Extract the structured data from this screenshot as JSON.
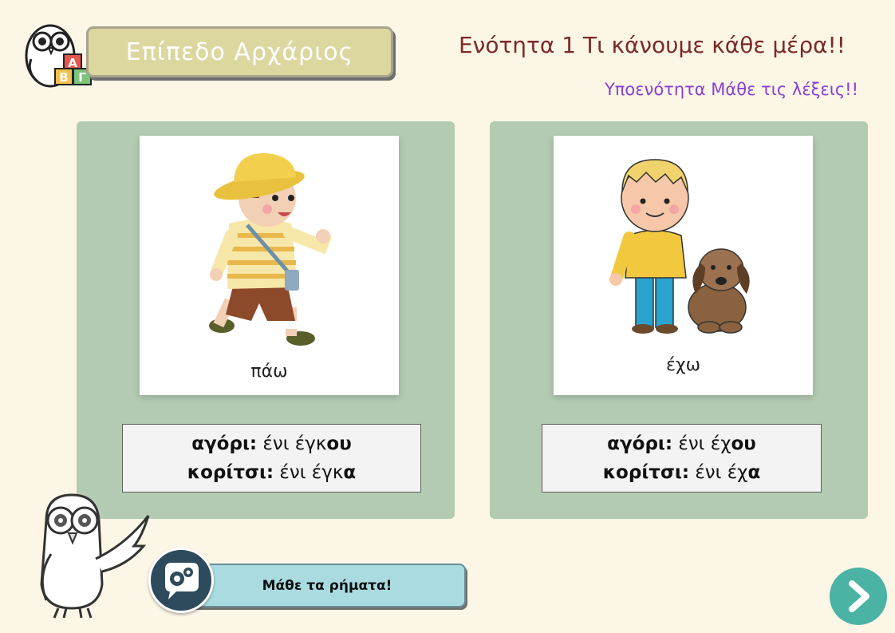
{
  "header": {
    "level_label": "Επίπεδο Αρχάριος",
    "logo_letters": [
      "A",
      "B",
      "Γ"
    ],
    "unit_title": "Ενότητα 1 Τι κάνουμε κάθε μέρα!!",
    "subunit_title": "Υποενότητα Μάθε τις λέξεις!!"
  },
  "cards": [
    {
      "word": "πάω",
      "illustration": "walking-boy",
      "conjugation": {
        "boy_label": "αγόρι:",
        "boy_stem": " ένι έγκ",
        "boy_ending": "ου",
        "girl_label": "κορίτσι:",
        "girl_stem": " ένι έγκ",
        "girl_ending": "α"
      }
    },
    {
      "word": "έχω",
      "illustration": "boy-with-dog",
      "conjugation": {
        "boy_label": "αγόρι:",
        "boy_stem": " ένι έχ",
        "boy_ending": "ου",
        "girl_label": "κορίτσι:",
        "girl_stem": " ένι έχ",
        "girl_ending": "α"
      }
    }
  ],
  "footer": {
    "verbs_button_label": "Μάθε τα ρήματα!",
    "verbs_icon": "gears-speech-icon",
    "next_icon": "chevron-right-icon"
  },
  "colors": {
    "background": "#fbf6e6",
    "panel": "#b3cbb2",
    "unit_title": "#7b2a2a",
    "subunit_title": "#8a3fd6",
    "next_button": "#4ab3a3",
    "verbs_button": "#a9dbe0"
  }
}
